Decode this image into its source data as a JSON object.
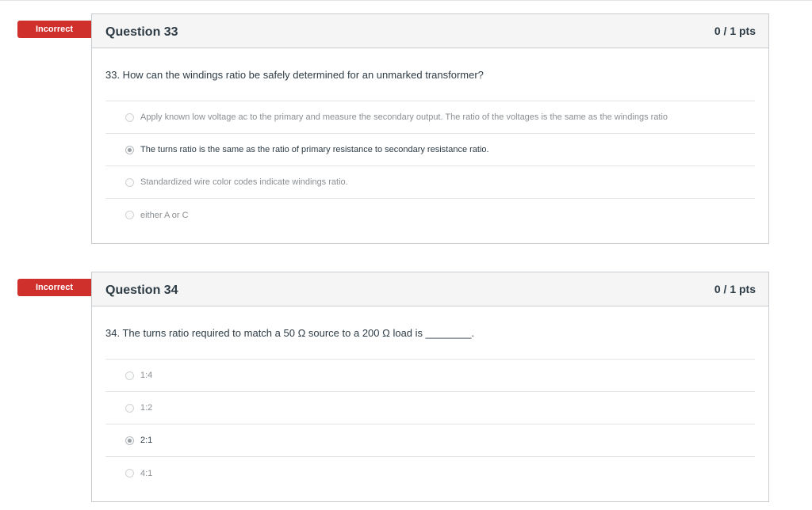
{
  "questions": [
    {
      "badge": "Incorrect",
      "title": "Question 33",
      "points": "0 / 1 pts",
      "text": "33. How can the windings ratio be safely determined for an unmarked transformer?",
      "answers": [
        {
          "label": "Apply known low voltage ac to the primary and measure the secondary output. The ratio of the voltages is the same as the windings ratio",
          "selected": false
        },
        {
          "label": "The turns ratio is the same as the ratio of primary resistance to secondary resistance ratio.",
          "selected": true
        },
        {
          "label": "Standardized wire color codes indicate windings ratio.",
          "selected": false
        },
        {
          "label": "either A or C",
          "selected": false
        }
      ]
    },
    {
      "badge": "Incorrect",
      "title": "Question 34",
      "points": "0 / 1 pts",
      "text": "34. The turns ratio required to match a 50 Ω source to a 200 Ω load is ________.",
      "answers": [
        {
          "label": "1:4",
          "selected": false
        },
        {
          "label": "1:2",
          "selected": false
        },
        {
          "label": "2:1",
          "selected": true
        },
        {
          "label": "4:1",
          "selected": false
        }
      ]
    }
  ],
  "colors": {
    "incorrect_badge": "#d0302c",
    "header_bg": "#f5f5f5",
    "border": "#c7cdd1",
    "text": "#2d3b45",
    "muted_text": "#8a8f93"
  },
  "icons": {
    "radio_unchecked": "radio-unchecked-icon",
    "radio_checked": "radio-checked-icon"
  }
}
